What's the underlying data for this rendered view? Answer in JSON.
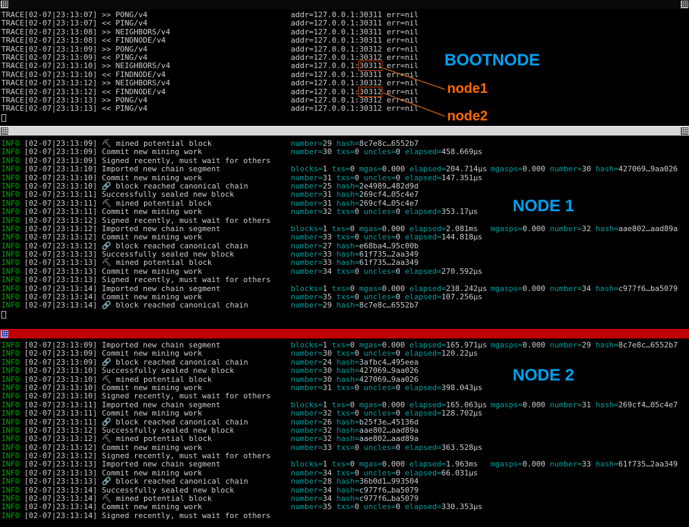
{
  "labels": {
    "bootnode": "BOOTNODE",
    "node1": "node1",
    "node2": "node2",
    "panel1": "NODE 1",
    "panel2": "NODE 2"
  },
  "colors": {
    "info_green": "#00aa00",
    "key_cyan": "#00a0a0",
    "label_blue": "#00a1f1",
    "label_orange": "#ff6a00",
    "highlight_box": "#d63c00",
    "titlebar_red": "#c00000",
    "titlebar_gray": "#d8d8d8",
    "terminal_bg": "#000000",
    "terminal_fg": "#cfcfcf"
  },
  "icons": {
    "pickaxe": "⛏",
    "chain": "🔗"
  },
  "bootnode_log": [
    {
      "ts": "02-07|23:13:07",
      "msg": ">> PONG/v4",
      "addr_ip": "127.0.0.1:",
      "port": "30311",
      "err": "nil",
      "boxed": false
    },
    {
      "ts": "02-07|23:13:07",
      "msg": "<< PING/v4",
      "addr_ip": "127.0.0.1:",
      "port": "30311",
      "err": "nil",
      "boxed": false
    },
    {
      "ts": "02-07|23:13:08",
      "msg": ">> NEIGHBORS/v4",
      "addr_ip": "127.0.0.1:",
      "port": "30311",
      "err": "nil",
      "boxed": false
    },
    {
      "ts": "02-07|23:13:08",
      "msg": "<< FINDNODE/v4",
      "addr_ip": "127.0.0.1:",
      "port": "30311",
      "err": "nil",
      "boxed": false
    },
    {
      "ts": "02-07|23:13:09",
      "msg": ">> PONG/v4",
      "addr_ip": "127.0.0.1:",
      "port": "30312",
      "err": "nil",
      "boxed": false
    },
    {
      "ts": "02-07|23:13:09",
      "msg": "<< PING/v4",
      "addr_ip": "127.0.0.1:",
      "port": "30312",
      "err": "nil",
      "boxed": false
    },
    {
      "ts": "02-07|23:13:10",
      "msg": ">> NEIGHBORS/v4",
      "addr_ip": "127.0.0.1:",
      "port": "30311",
      "err": "nil",
      "boxed": true
    },
    {
      "ts": "02-07|23:13:10",
      "msg": "<< FINDNODE/v4",
      "addr_ip": "127.0.0.1:",
      "port": "30311",
      "err": "nil",
      "boxed": false
    },
    {
      "ts": "02-07|23:13:12",
      "msg": ">> NEIGHBORS/v4",
      "addr_ip": "127.0.0.1:",
      "port": "30312",
      "err": "nil",
      "boxed": false
    },
    {
      "ts": "02-07|23:13:12",
      "msg": "<< FINDNODE/v4",
      "addr_ip": "127.0.0.1:",
      "port": "30312",
      "err": "nil",
      "boxed": true
    },
    {
      "ts": "02-07|23:13:13",
      "msg": ">> PONG/v4",
      "addr_ip": "127.0.0.1:",
      "port": "30312",
      "err": "nil",
      "boxed": false
    },
    {
      "ts": "02-07|23:13:13",
      "msg": "<< PING/v4",
      "addr_ip": "127.0.0.1:",
      "port": "30312",
      "err": "nil",
      "boxed": false
    }
  ],
  "node1_log": [
    {
      "ts": "02-07|23:13:09",
      "icon": "pickaxe",
      "msg": "mined potential block",
      "kv": [
        [
          "number",
          "29"
        ],
        [
          "hash",
          "8c7e8c…6552b7"
        ]
      ]
    },
    {
      "ts": "02-07|23:13:09",
      "msg": "Commit new mining work",
      "kv": [
        [
          "number",
          "30"
        ],
        [
          "txs",
          "0"
        ],
        [
          "uncles",
          "0"
        ],
        [
          "elapsed",
          "458.669µs"
        ]
      ]
    },
    {
      "ts": "02-07|23:13:09",
      "msg": "Signed recently, must wait for others"
    },
    {
      "ts": "02-07|23:13:10",
      "msg": "Imported new chain segment",
      "kv": [
        [
          "blocks",
          "1"
        ],
        [
          "txs",
          "0"
        ],
        [
          "mgas",
          "0.000"
        ],
        [
          "elapsed",
          "204.714µs"
        ]
      ],
      "kv2": [
        [
          "mgasps",
          "0.000"
        ],
        [
          "number",
          "30"
        ],
        [
          "hash",
          "427069…9aa026"
        ]
      ]
    },
    {
      "ts": "02-07|23:13:10",
      "msg": "Commit new mining work",
      "kv": [
        [
          "number",
          "31"
        ],
        [
          "txs",
          "0"
        ],
        [
          "uncles",
          "0"
        ],
        [
          "elapsed",
          "147.351µs"
        ]
      ]
    },
    {
      "ts": "02-07|23:13:10",
      "icon": "chain",
      "msg": "block reached canonical chain",
      "kv": [
        [
          "number",
          "25"
        ],
        [
          "hash",
          "2e4989…482d9d"
        ]
      ]
    },
    {
      "ts": "02-07|23:13:11",
      "msg": "Successfully sealed new block",
      "kv": [
        [
          "number",
          "31"
        ],
        [
          "hash",
          "269cf4…05c4e7"
        ]
      ]
    },
    {
      "ts": "02-07|23:13:11",
      "icon": "pickaxe",
      "msg": "mined potential block",
      "kv": [
        [
          "number",
          "31"
        ],
        [
          "hash",
          "269cf4…05c4e7"
        ]
      ]
    },
    {
      "ts": "02-07|23:13:11",
      "msg": "Commit new mining work",
      "kv": [
        [
          "number",
          "32"
        ],
        [
          "txs",
          "0"
        ],
        [
          "uncles",
          "0"
        ],
        [
          "elapsed",
          "353.17µs"
        ]
      ]
    },
    {
      "ts": "02-07|23:13:12",
      "msg": "Signed recently, must wait for others"
    },
    {
      "ts": "02-07|23:13:12",
      "msg": "Imported new chain segment",
      "kv": [
        [
          "blocks",
          "1"
        ],
        [
          "txs",
          "0"
        ],
        [
          "mgas",
          "0.000"
        ],
        [
          "elapsed",
          "2.081ms"
        ]
      ],
      "kv2": [
        [
          "mgasps",
          "0.000"
        ],
        [
          "number",
          "32"
        ],
        [
          "hash",
          "aae802…aad89a"
        ]
      ]
    },
    {
      "ts": "02-07|23:13:12",
      "msg": "Commit new mining work",
      "kv": [
        [
          "number",
          "33"
        ],
        [
          "txs",
          "0"
        ],
        [
          "uncles",
          "0"
        ],
        [
          "elapsed",
          "144.818µs"
        ]
      ]
    },
    {
      "ts": "02-07|23:13:12",
      "icon": "chain",
      "msg": "block reached canonical chain",
      "kv": [
        [
          "number",
          "27"
        ],
        [
          "hash",
          "e68ba4…95c00b"
        ]
      ]
    },
    {
      "ts": "02-07|23:13:13",
      "msg": "Successfully sealed new block",
      "kv": [
        [
          "number",
          "33"
        ],
        [
          "hash",
          "61f735…2aa349"
        ]
      ]
    },
    {
      "ts": "02-07|23:13:13",
      "icon": "pickaxe",
      "msg": "mined potential block",
      "kv": [
        [
          "number",
          "33"
        ],
        [
          "hash",
          "61f735…2aa349"
        ]
      ]
    },
    {
      "ts": "02-07|23:13:13",
      "msg": "Commit new mining work",
      "kv": [
        [
          "number",
          "34"
        ],
        [
          "txs",
          "0"
        ],
        [
          "uncles",
          "0"
        ],
        [
          "elapsed",
          "270.592µs"
        ]
      ]
    },
    {
      "ts": "02-07|23:13:13",
      "msg": "Signed recently, must wait for others"
    },
    {
      "ts": "02-07|23:13:14",
      "msg": "Imported new chain segment",
      "kv": [
        [
          "blocks",
          "1"
        ],
        [
          "txs",
          "0"
        ],
        [
          "mgas",
          "0.000"
        ],
        [
          "elapsed",
          "238.242µs"
        ]
      ],
      "kv2": [
        [
          "mgasps",
          "0.000"
        ],
        [
          "number",
          "34"
        ],
        [
          "hash",
          "c977f6…ba5079"
        ]
      ]
    },
    {
      "ts": "02-07|23:13:14",
      "msg": "Commit new mining work",
      "kv": [
        [
          "number",
          "35"
        ],
        [
          "txs",
          "0"
        ],
        [
          "uncles",
          "0"
        ],
        [
          "elapsed",
          "107.256µs"
        ]
      ]
    },
    {
      "ts": "02-07|23:13:14",
      "icon": "chain",
      "msg": "block reached canonical chain",
      "kv": [
        [
          "number",
          "29"
        ],
        [
          "hash",
          "8c7e8c…6552b7"
        ]
      ]
    }
  ],
  "node2_log": [
    {
      "ts": "02-07|23:13:09",
      "msg": "Imported new chain segment",
      "kv": [
        [
          "blocks",
          "1"
        ],
        [
          "txs",
          "0"
        ],
        [
          "mgas",
          "0.000"
        ],
        [
          "elapsed",
          "165.971µs"
        ]
      ],
      "kv2": [
        [
          "mgasps",
          "0.000"
        ],
        [
          "number",
          "29"
        ],
        [
          "hash",
          "8c7e8c…6552b7"
        ]
      ]
    },
    {
      "ts": "02-07|23:13:09",
      "msg": "Commit new mining work",
      "kv": [
        [
          "number",
          "30"
        ],
        [
          "txs",
          "0"
        ],
        [
          "uncles",
          "0"
        ],
        [
          "elapsed",
          "120.22µs"
        ]
      ]
    },
    {
      "ts": "02-07|23:13:09",
      "icon": "chain",
      "msg": "block reached canonical chain",
      "kv": [
        [
          "number",
          "24"
        ],
        [
          "hash",
          "3afbc4…495eea"
        ]
      ]
    },
    {
      "ts": "02-07|23:13:10",
      "msg": "Successfully sealed new block",
      "kv": [
        [
          "number",
          "30"
        ],
        [
          "hash",
          "427069…9aa026"
        ]
      ]
    },
    {
      "ts": "02-07|23:13:10",
      "icon": "pickaxe",
      "msg": "mined potential block",
      "kv": [
        [
          "number",
          "30"
        ],
        [
          "hash",
          "427069…9aa026"
        ]
      ]
    },
    {
      "ts": "02-07|23:13:10",
      "msg": "Commit new mining work",
      "kv": [
        [
          "number",
          "31"
        ],
        [
          "txs",
          "0"
        ],
        [
          "uncles",
          "0"
        ],
        [
          "elapsed",
          "398.043µs"
        ]
      ]
    },
    {
      "ts": "02-07|23:13:10",
      "msg": "Signed recently, must wait for others"
    },
    {
      "ts": "02-07|23:13:11",
      "msg": "Imported new chain segment",
      "kv": [
        [
          "blocks",
          "1"
        ],
        [
          "txs",
          "0"
        ],
        [
          "mgas",
          "0.000"
        ],
        [
          "elapsed",
          "165.063µs"
        ]
      ],
      "kv2": [
        [
          "mgasps",
          "0.000"
        ],
        [
          "number",
          "31"
        ],
        [
          "hash",
          "269cf4…05c4e7"
        ]
      ]
    },
    {
      "ts": "02-07|23:13:11",
      "msg": "Commit new mining work",
      "kv": [
        [
          "number",
          "32"
        ],
        [
          "txs",
          "0"
        ],
        [
          "uncles",
          "0"
        ],
        [
          "elapsed",
          "128.702µs"
        ]
      ]
    },
    {
      "ts": "02-07|23:13:11",
      "icon": "chain",
      "msg": "block reached canonical chain",
      "kv": [
        [
          "number",
          "26"
        ],
        [
          "hash",
          "b25f3e…45136d"
        ]
      ]
    },
    {
      "ts": "02-07|23:13:12",
      "msg": "Successfully sealed new block",
      "kv": [
        [
          "number",
          "32"
        ],
        [
          "hash",
          "aae802…aad89a"
        ]
      ]
    },
    {
      "ts": "02-07|23:13:12",
      "icon": "pickaxe",
      "msg": "mined potential block",
      "kv": [
        [
          "number",
          "32"
        ],
        [
          "hash",
          "aae802…aad89a"
        ]
      ]
    },
    {
      "ts": "02-07|23:13:12",
      "msg": "Commit new mining work",
      "kv": [
        [
          "number",
          "33"
        ],
        [
          "txs",
          "0"
        ],
        [
          "uncles",
          "0"
        ],
        [
          "elapsed",
          "363.528µs"
        ]
      ]
    },
    {
      "ts": "02-07|23:13:12",
      "msg": "Signed recently, must wait for others"
    },
    {
      "ts": "02-07|23:13:13",
      "msg": "Imported new chain segment",
      "kv": [
        [
          "blocks",
          "1"
        ],
        [
          "txs",
          "0"
        ],
        [
          "mgas",
          "0.000"
        ],
        [
          "elapsed",
          "1.963ms"
        ]
      ],
      "kv2": [
        [
          "mgasps",
          "0.000"
        ],
        [
          "number",
          "33"
        ],
        [
          "hash",
          "61f735…2aa349"
        ]
      ]
    },
    {
      "ts": "02-07|23:13:13",
      "msg": "Commit new mining work",
      "kv": [
        [
          "number",
          "34"
        ],
        [
          "txs",
          "0"
        ],
        [
          "uncles",
          "0"
        ],
        [
          "elapsed",
          "66.031µs"
        ]
      ]
    },
    {
      "ts": "02-07|23:13:13",
      "icon": "chain",
      "msg": "block reached canonical chain",
      "kv": [
        [
          "number",
          "28"
        ],
        [
          "hash",
          "36b0d1…993504"
        ]
      ]
    },
    {
      "ts": "02-07|23:13:14",
      "msg": "Successfully sealed new block",
      "kv": [
        [
          "number",
          "34"
        ],
        [
          "hash",
          "c977f6…ba5079"
        ]
      ]
    },
    {
      "ts": "02-07|23:13:14",
      "icon": "pickaxe",
      "msg": "mined potential block",
      "kv": [
        [
          "number",
          "34"
        ],
        [
          "hash",
          "c977f6…ba5079"
        ]
      ]
    },
    {
      "ts": "02-07|23:13:14",
      "msg": "Commit new mining work",
      "kv": [
        [
          "number",
          "35"
        ],
        [
          "txs",
          "0"
        ],
        [
          "uncles",
          "0"
        ],
        [
          "elapsed",
          "330.353µs"
        ]
      ]
    },
    {
      "ts": "02-07|23:13:14",
      "msg": "Signed recently, must wait for others"
    }
  ]
}
